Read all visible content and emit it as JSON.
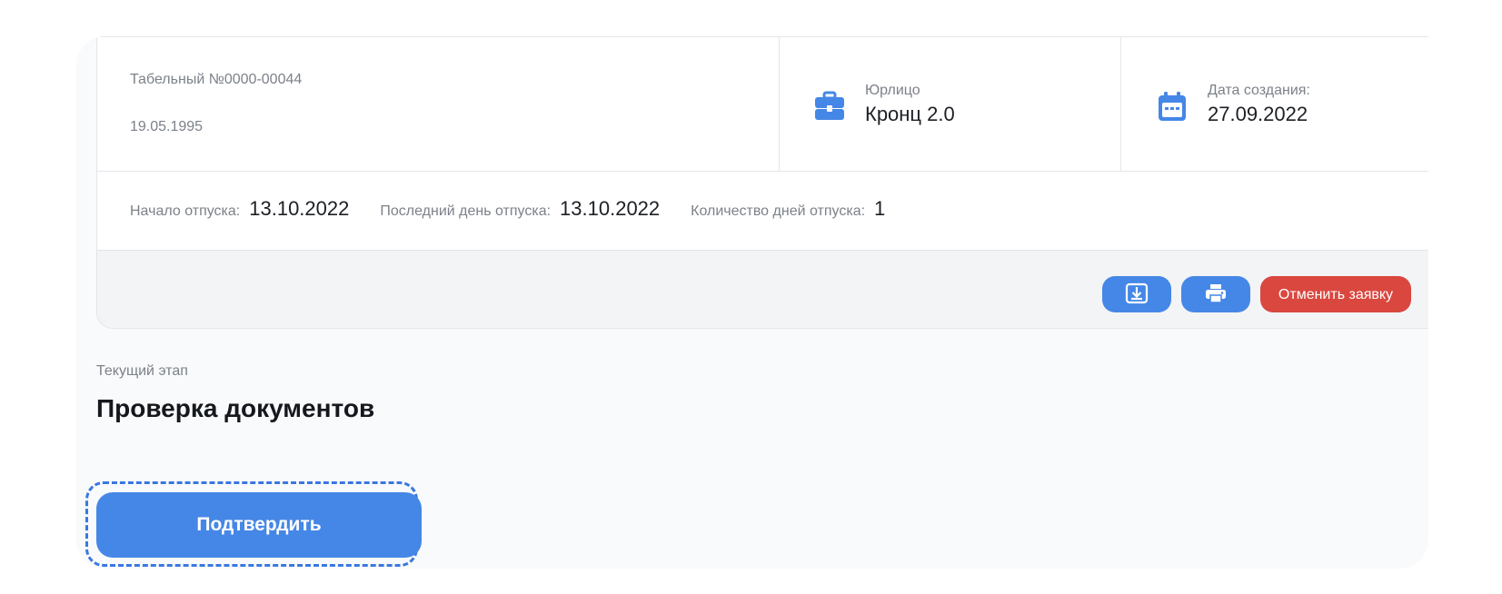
{
  "employee": {
    "tab_number": "Табельный №0000-00044",
    "birth_date": "19.05.1995"
  },
  "organization": {
    "label": "Юрлицо",
    "value": "Кронц 2.0",
    "icon": "briefcase-icon"
  },
  "created": {
    "label": "Дата создания:",
    "value": "27.09.2022",
    "icon": "calendar-icon"
  },
  "vacation": {
    "start_label": "Начало отпуска:",
    "start_value": "13.10.2022",
    "end_label": "Последний день отпуска:",
    "end_value": "13.10.2022",
    "days_label": "Количество дней отпуска:",
    "days_value": "1"
  },
  "actions": {
    "download_icon": "download-icon",
    "print_icon": "printer-icon",
    "cancel_label": "Отменить заявку"
  },
  "stage": {
    "label": "Текущий этап",
    "title": "Проверка документов"
  },
  "confirm": {
    "label": "Подтвердить"
  },
  "colors": {
    "accent": "#4587e6",
    "danger": "#d9473f",
    "focus": "#3a78e0"
  }
}
